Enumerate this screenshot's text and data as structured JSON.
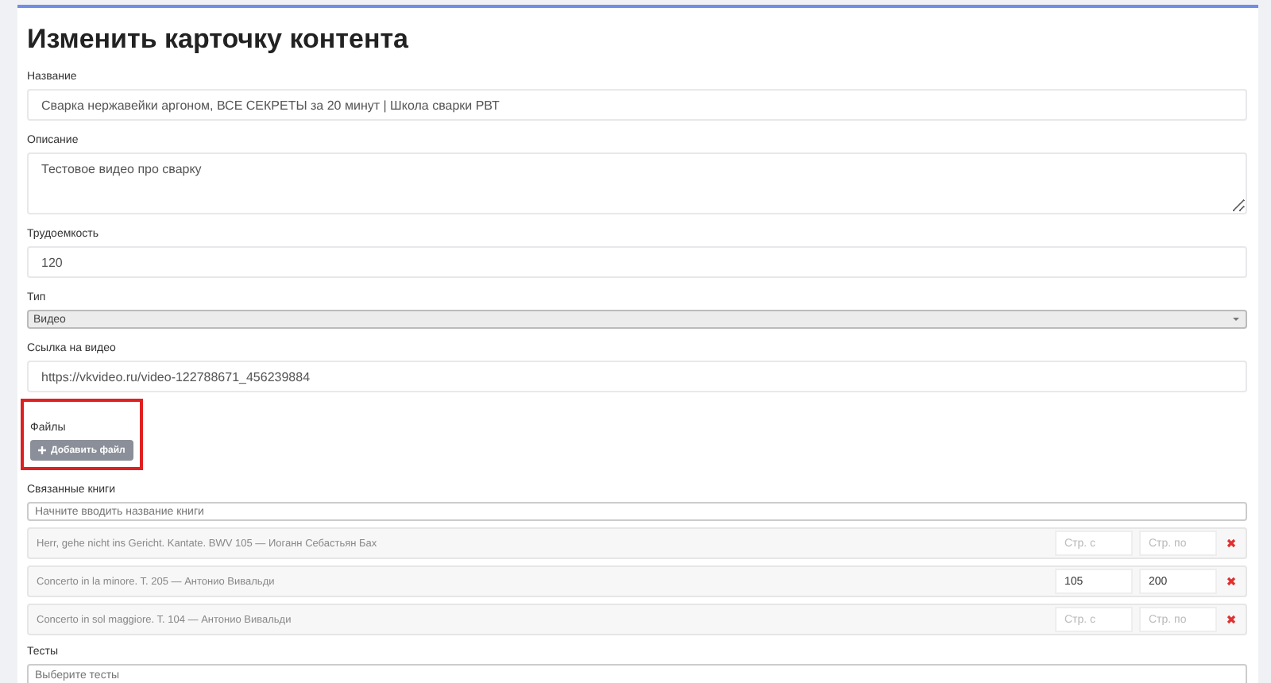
{
  "title": "Изменить карточку контента",
  "fields": [
    {
      "label": "Название",
      "kind": "input",
      "value": "Сварка нержавейки аргоном, ВСЕ СЕКРЕТЫ за 20 минут | Школа сварки РВТ"
    },
    {
      "label": "Описание",
      "kind": "textarea",
      "value": "Тестовое видео про сварку"
    },
    {
      "label": "Трудоемкость",
      "kind": "input",
      "value": "120"
    },
    {
      "label": "Тип",
      "kind": "select",
      "value": "Видео"
    },
    {
      "label": "Ссылка на видео",
      "kind": "input",
      "value": "https://vkvideo.ru/video-122788671_456239884"
    }
  ],
  "files": {
    "label": "Файлы",
    "button": "Добавить файл",
    "highlighted": true
  },
  "books": {
    "label": "Связанные книги",
    "placeholder": "Начните вводить название книги",
    "items": [
      {
        "title": "Herr, gehe nicht ins Gericht. Kantate. BWV 105 — Иоганн Себастьян Бах",
        "from_placeholder": "Стр. с",
        "to_placeholder": "Стр. по"
      },
      {
        "title": "Concerto in la minore. T. 205 — Антонио Вивальди",
        "from": "105",
        "to": "200"
      },
      {
        "title": "Concerto in sol maggiore. T. 104 — Антонио Вивальди",
        "from_placeholder": "Стр. с",
        "to_placeholder": "Стр. по"
      }
    ]
  },
  "tests": {
    "label": "Тесты",
    "placeholder": "Выберите тесты"
  }
}
